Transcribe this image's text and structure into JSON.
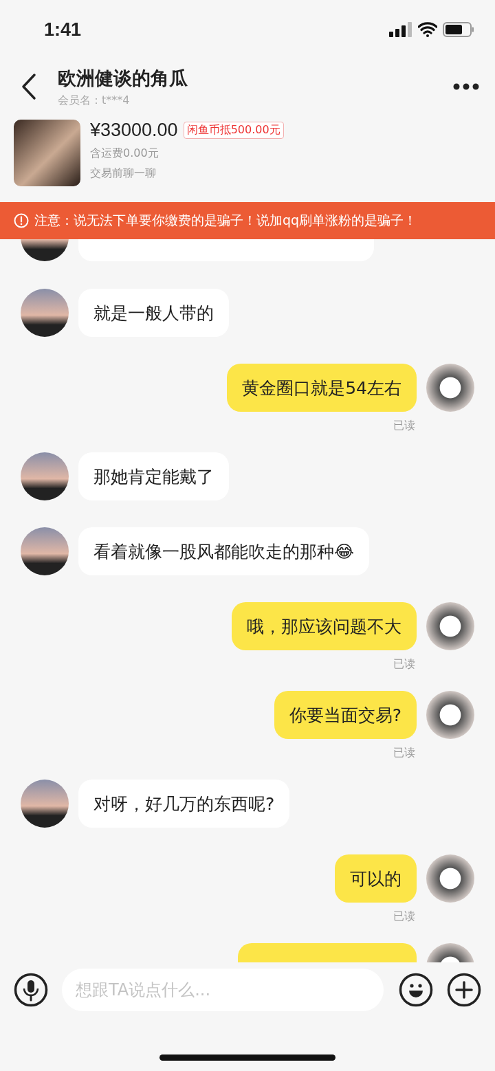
{
  "status_bar": {
    "time": "1:41"
  },
  "header": {
    "title": "欧洲健谈的角瓜",
    "subtitle": "会员名：t***4"
  },
  "product": {
    "price": "¥33000.00",
    "coupon": "闲鱼币抵500.00元",
    "shipping": "含运费0.00元",
    "note": "交易前聊一聊"
  },
  "notice": {
    "text": "注意：说无法下单要你缴费的是骗子！说加qq刷单涨粉的是骗子！"
  },
  "messages": [
    {
      "kind": "partial",
      "from_me": false
    },
    {
      "kind": "text",
      "from_me": false,
      "text": "就是一般人带的"
    },
    {
      "kind": "text",
      "from_me": true,
      "text": "黄金圈口就是54左右",
      "status": "已读"
    },
    {
      "kind": "text",
      "from_me": false,
      "text": "那她肯定能戴了"
    },
    {
      "kind": "text",
      "from_me": false,
      "text": "看着就像一股风都能吹走的那种😂"
    },
    {
      "kind": "text",
      "from_me": true,
      "text": "哦，那应该问题不大",
      "status": "已读"
    },
    {
      "kind": "text",
      "from_me": true,
      "text": "你要当面交易?",
      "status": "已读"
    },
    {
      "kind": "text",
      "from_me": false,
      "text": "对呀，好几万的东西呢?"
    },
    {
      "kind": "text",
      "from_me": true,
      "text": "可以的",
      "status": "已读"
    },
    {
      "kind": "partial",
      "from_me": true
    }
  ],
  "input": {
    "placeholder": "想跟TA说点什么..."
  }
}
